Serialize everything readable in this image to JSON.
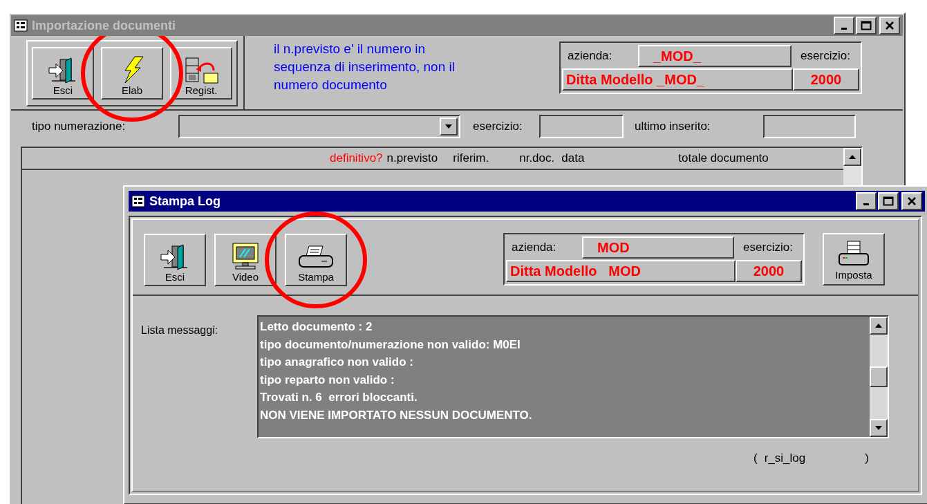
{
  "back_window": {
    "title": "Importazione documenti",
    "active": false,
    "toolbar": [
      {
        "kind": "exit",
        "label": "Esci",
        "highlighted": false
      },
      {
        "kind": "process",
        "label": "Elab",
        "highlighted": true
      },
      {
        "kind": "register",
        "label": "Regist.",
        "highlighted": false
      }
    ],
    "note": "il n.previsto e' il numero in sequenza di inserimento, non il numero documento",
    "company": {
      "azienda_label": "azienda:",
      "azienda": "_MOD_",
      "esercizio_label": "esercizio:",
      "name": "Ditta Modello _MOD_",
      "year": "2000"
    },
    "filters": {
      "numerazione_label": "tipo numerazione:",
      "esercizio_label": "esercizio:",
      "ultimo_label": "ultimo inserito:"
    },
    "columns": [
      {
        "label": "definitivo?",
        "color": "#ff0000"
      },
      {
        "label": "n.previsto",
        "color": "#000000"
      },
      {
        "label": "riferim.",
        "color": "#000000"
      },
      {
        "label": "nr.doc.",
        "color": "#000000"
      },
      {
        "label": "data",
        "color": "#000000"
      },
      {
        "label": "totale documento",
        "color": "#000000"
      }
    ]
  },
  "front_window": {
    "title": "Stampa Log",
    "active": true,
    "toolbar": [
      {
        "kind": "exit",
        "label": "Esci",
        "highlighted": false
      },
      {
        "kind": "monitor",
        "label": "Video",
        "highlighted": false
      },
      {
        "kind": "printer",
        "label": "Stampa",
        "highlighted": true
      }
    ],
    "company": {
      "azienda_label": "azienda:",
      "azienda": "MOD",
      "esercizio_label": "esercizio:",
      "name": "Ditta Modello   MOD",
      "year": "2000"
    },
    "setup_button": {
      "label": "Imposta"
    },
    "messages_label": "Lista messaggi:",
    "messages": [
      "Letto documento : 2",
      "tipo documento/numerazione non valido: M0EI",
      "tipo anagrafico non valido :",
      "tipo reparto non valido :",
      "Trovati n. 6  errori bloccanti.",
      "NON VIENE IMPORTATO NESSUN DOCUMENTO."
    ],
    "footer": {
      "open": "(",
      "code": "r_si_log",
      "close": ")"
    }
  }
}
